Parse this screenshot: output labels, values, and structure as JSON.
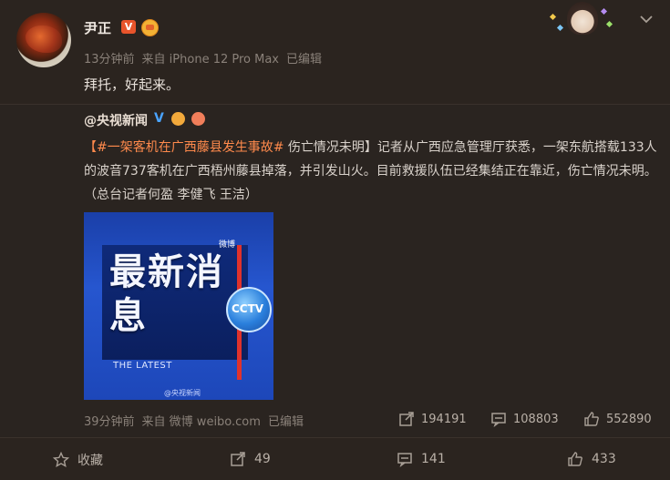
{
  "post": {
    "username": "尹正",
    "v_badge": "V",
    "time": "13分钟前",
    "source": "来自 iPhone 12 Pro Max",
    "edited": "已编辑",
    "text": "拜托，好起来。"
  },
  "repost": {
    "author": "@央视新闻",
    "hashtag": "【#一架客机在广西藤县发生事故#",
    "body": " 伤亡情况未明】记者从广西应急管理厅获悉，一架东航搭载133人的波音737客机在广西梧州藤县掉落，并引发山火。目前救援队伍已经集结正在靠近，伤亡情况未明。（总台记者何盈 李健飞 王洁）",
    "image": {
      "headline": "最新消息",
      "subtitle": "THE LATEST",
      "tv_logo": "CCTV",
      "top_mark": "微博",
      "watermark": "@央视新闻"
    },
    "time": "39分钟前",
    "source": "来自 微博 weibo.com",
    "edited": "已编辑",
    "reposts": "194191",
    "comments": "108803",
    "likes": "552890"
  },
  "actions": {
    "favorite": "收藏",
    "repost": "49",
    "comment": "141",
    "like": "433"
  },
  "colors": {
    "background": "#2b241f",
    "hashtag": "#ff8a4c",
    "v_badge": "#e8542b",
    "image_blue": "#2656cf"
  }
}
